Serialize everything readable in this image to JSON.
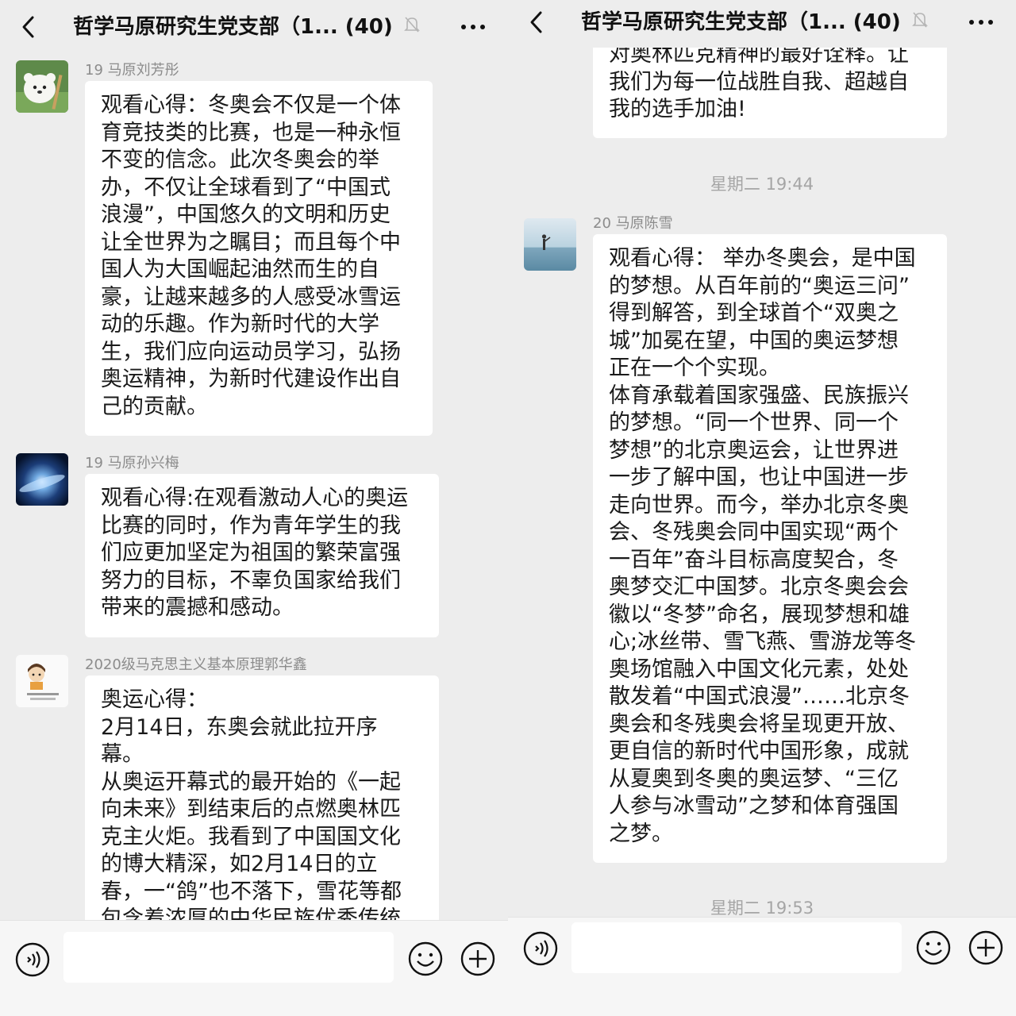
{
  "left": {
    "header": {
      "title": "哲学马原研究生党支部（1... (40)",
      "muted_icon": "bell-off-icon",
      "back_icon": "chevron-left-icon",
      "more_icon": "ellipsis-icon"
    },
    "messages": [
      {
        "sender": "19 马原刘芳彤",
        "avatar_icon": "cartoon-cat-avatar",
        "text": "观看心得：冬奥会不仅是一个体\n育竞技类的比赛，也是一种永恒\n不变的信念。此次冬奥会的举\n办，不仅让全球看到了“中国式\n浪漫”，中国悠久的文明和历史\n让全世界为之瞩目；而且每个中\n国人为大国崛起油然而生的自\n豪，让越来越多的人感受冰雪运\n动的乐趣。作为新时代的大学\n生，我们应向运动员学习，弘扬\n奥运精神，为新时代建设作出自\n己的贡献。"
      },
      {
        "sender": "19 马原孙兴梅",
        "avatar_icon": "galaxy-avatar",
        "text": "观看心得:在观看激动人心的奥运\n比赛的同时，作为青年学生的我\n们应更加坚定为祖国的繁荣富强\n努力的目标，不辜负国家给我们\n带来的震撼和感动。"
      },
      {
        "sender": "2020级马克思主义基本原理郭华鑫",
        "avatar_icon": "cartoon-girl-avatar",
        "text": "奥运心得：\n2月14日，东奥会就此拉开序\n幕。\n从奥运开幕式的最开始的《一起\n向未来》到结束后的点燃奥林匹\n克主火炬。我看到了中国国文化\n的博大精深，如2月14日的立\n春，一“鸽”也不落下，雪花等都\n包含着浓厚的中华民族优秀传统"
      }
    ],
    "inputbar": {
      "voice_icon": "voice-icon",
      "emoji_icon": "smiley-icon",
      "plus_icon": "plus-circle-icon",
      "placeholder": ""
    }
  },
  "right": {
    "header": {
      "title": "哲学马原研究生党支部（1... (40)",
      "muted_icon": "bell-off-icon",
      "back_icon": "chevron-left-icon",
      "more_icon": "ellipsis-icon"
    },
    "partial_message": {
      "text": "对奥林匹克精神的最好诠释。让\n我们为每一位战胜自我、超越自\n我的选手加油!"
    },
    "time1": "星期二 19:44",
    "message": {
      "sender": "20 马原陈雪",
      "avatar_icon": "beach-person-avatar",
      "text": "观看心得： 举办冬奥会，是中国\n的梦想。从百年前的“奥运三问”\n得到解答，到全球首个“双奥之\n城”加冕在望，中国的奥运梦想\n正在一个个实现。\n体育承载着国家强盛、民族振兴\n的梦想。“同一个世界、同一个\n梦想”的北京奥运会，让世界进\n一步了解中国，也让中国进一步\n走向世界。而今，举办北京冬奥\n会、冬残奥会同中国实现“两个\n一百年”奋斗目标高度契合，冬\n奥梦交汇中国梦。北京冬奥会会\n徽以“冬梦”命名，展现梦想和雄\n心;冰丝带、雪飞燕、雪游龙等冬\n奥场馆融入中国文化元素，处处\n散发着“中国式浪漫”……北京冬\n奥会和冬残奥会将呈现更开放、\n更自信的新时代中国形象，成就\n从夏奥到冬奥的奥运梦、“三亿\n人参与冰雪动”之梦和体育强国\n之梦。"
    },
    "time2": "星期二 19:53",
    "inputbar": {
      "voice_icon": "voice-icon",
      "emoji_icon": "smiley-icon",
      "plus_icon": "plus-circle-icon",
      "placeholder": ""
    }
  },
  "colors": {
    "background": "#ededed",
    "bubble": "#ffffff",
    "sender": "#8c8c8c",
    "time": "#a5a5a5",
    "text": "#1a1a1a"
  }
}
